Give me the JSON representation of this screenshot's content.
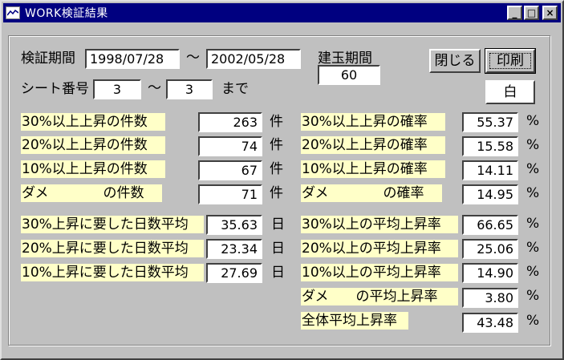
{
  "window": {
    "title": "WORK検証結果",
    "minimize": "_",
    "maximize": "□",
    "close": "×"
  },
  "header": {
    "period_label": "検証期間",
    "period_start": "1998/07/28",
    "tilde": "〜",
    "period_end": "2002/05/28",
    "position_period_label": "建玉期間",
    "position_period_value": "60",
    "sheet_label": "シート番号",
    "sheet_start": "3",
    "sheet_end": "3",
    "made": "まで",
    "close_button": "閉じる",
    "print_button": "印刷",
    "white_button": "白"
  },
  "counts": [
    {
      "label": "30%以上上昇の件数",
      "value": "263",
      "unit": "件"
    },
    {
      "label": "20%以上上昇の件数",
      "value": "74",
      "unit": "件"
    },
    {
      "label": "10%以上上昇の件数",
      "value": "67",
      "unit": "件"
    },
    {
      "label": "ダメ　　　　の件数",
      "value": "71",
      "unit": "件"
    }
  ],
  "probabilities": [
    {
      "label": "30%以上上昇の確率",
      "value": "55.37",
      "unit": "%"
    },
    {
      "label": "20%以上上昇の確率",
      "value": "15.58",
      "unit": "%"
    },
    {
      "label": "10%以上上昇の確率",
      "value": "14.11",
      "unit": "%"
    },
    {
      "label": "ダメ　　　　の確率",
      "value": "14.95",
      "unit": "%"
    }
  ],
  "days": [
    {
      "label": "30%上昇に要した日数平均",
      "value": "35.63",
      "unit": "日"
    },
    {
      "label": "20%上昇に要した日数平均",
      "value": "23.34",
      "unit": "日"
    },
    {
      "label": "10%上昇に要した日数平均",
      "value": "27.69",
      "unit": "日"
    }
  ],
  "avg_rates": [
    {
      "label": "30%以上の平均上昇率",
      "value": "66.65",
      "unit": "%"
    },
    {
      "label": "20%以上の平均上昇率",
      "value": "25.06",
      "unit": "%"
    },
    {
      "label": "10%以上の平均上昇率",
      "value": "14.90",
      "unit": "%"
    },
    {
      "label": "ダメ　　の平均上昇率",
      "value": "3.80",
      "unit": "%"
    },
    {
      "label": "全体平均上昇率",
      "value": "43.48",
      "unit": "%"
    }
  ]
}
